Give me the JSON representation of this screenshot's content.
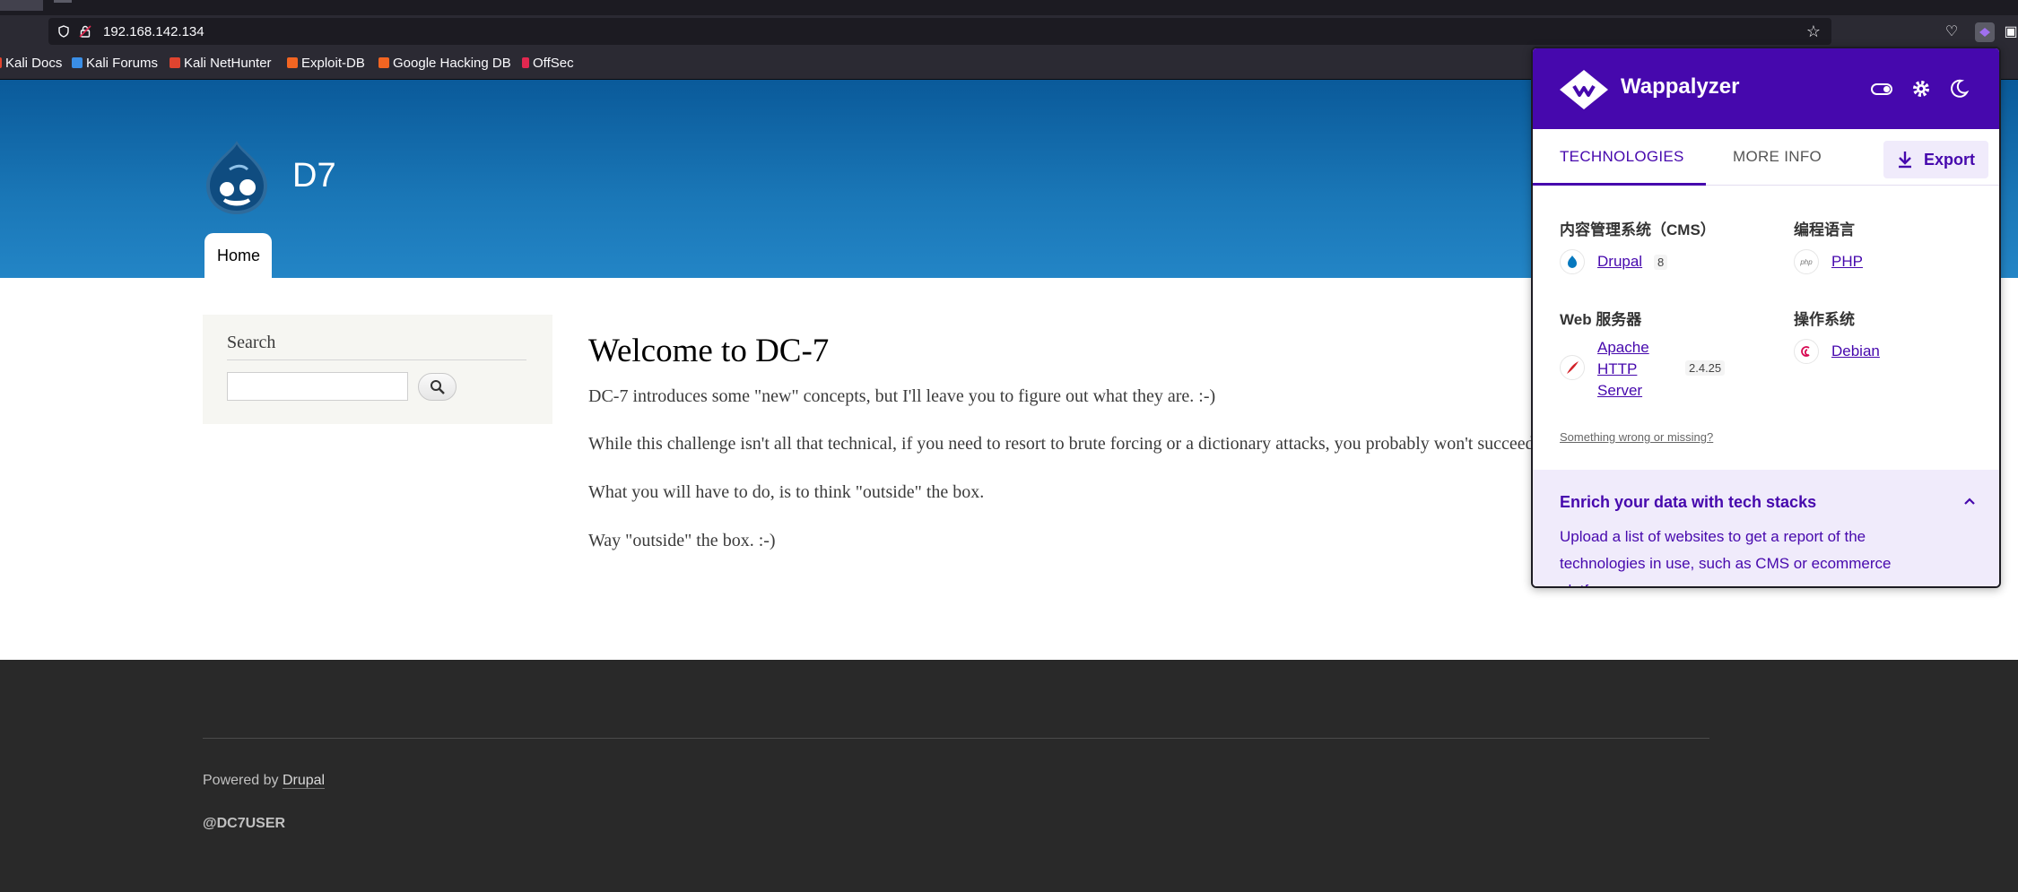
{
  "browser": {
    "url": "192.168.142.134",
    "bookmarks": [
      "Kali Docs",
      "Kali Forums",
      "Kali NetHunter",
      "Exploit-DB",
      "Google Hacking DB",
      "OffSec"
    ]
  },
  "site": {
    "name": "D7",
    "nav": {
      "home": "Home"
    },
    "search": {
      "title": "Search"
    },
    "content": {
      "title": "Welcome to DC-7",
      "paragraphs": [
        "DC-7 introduces some \"new\" concepts, but I'll leave you to figure out what they are.  :-)",
        "While this challenge isn't all that technical, if you need to resort to brute forcing or a dictionary attacks, you probably won't succeed",
        "What you will have to do, is to think \"outside\" the box.",
        "Way \"outside\" the box.  :-)"
      ]
    },
    "footer": {
      "powered_prefix": "Powered by ",
      "powered_link": "Drupal",
      "user": "@DC7USER"
    }
  },
  "wappalyzer": {
    "title": "Wappalyzer",
    "tabs": {
      "technologies": "TECHNOLOGIES",
      "more_info": "MORE INFO"
    },
    "export": "Export",
    "categories": {
      "cms": {
        "title": "内容管理系统（CMS）",
        "tech": {
          "name": "Drupal",
          "version": "8"
        }
      },
      "lang": {
        "title": "编程语言",
        "tech": {
          "name": "PHP"
        }
      },
      "web": {
        "title": "Web 服务器",
        "tech": {
          "name_lines": [
            "Apache",
            "HTTP",
            "Server"
          ],
          "version": "2.4.25"
        }
      },
      "os": {
        "title": "操作系统",
        "tech": {
          "name": "Debian"
        }
      }
    },
    "wrong_link": "Something wrong or missing?",
    "enrich": {
      "title": "Enrich your data with tech stacks",
      "text": "Upload a list of websites to get a report of the technologies in use, such as CMS or ecommerce platforms."
    },
    "colors": {
      "brand": "#4608ad",
      "accent_bg": "#f0ebfb"
    }
  }
}
